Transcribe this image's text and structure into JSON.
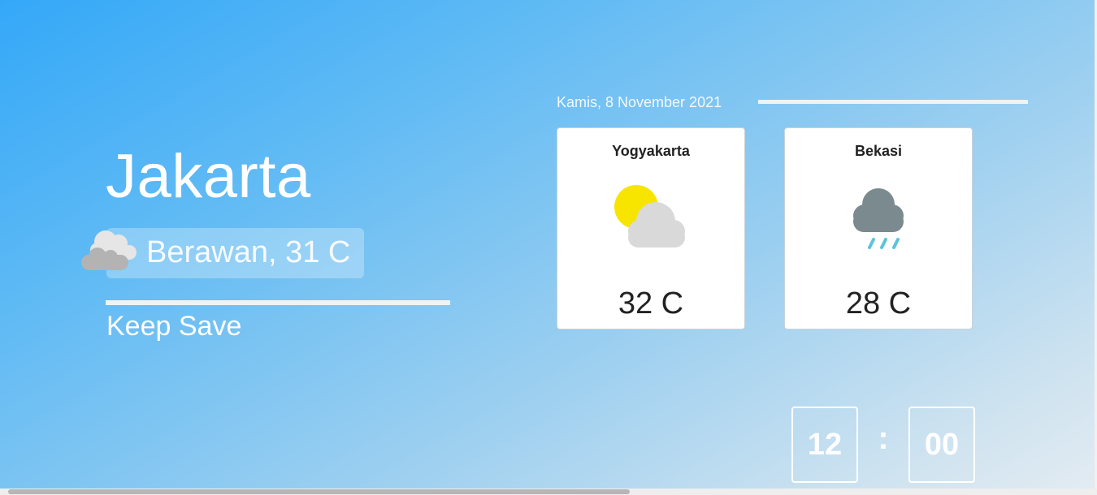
{
  "main": {
    "city": "Jakarta",
    "condition": "Berawan, 31 C",
    "condition_icon": "cloud-icon",
    "subtitle": "Keep Save"
  },
  "date": "Kamis, 8 November 2021",
  "cards": [
    {
      "city": "Yogyakarta",
      "icon": "partly-sunny-icon",
      "temp": "32 C"
    },
    {
      "city": "Bekasi",
      "icon": "rain-cloud-icon",
      "temp": "28 C"
    }
  ],
  "clock": {
    "hours": "12",
    "separator": ":",
    "minutes": "00"
  },
  "colors": {
    "background_start": "#34a8f8",
    "background_end": "#e4ecf2",
    "sun": "#f7e500",
    "cloud_light": "#d9d9d9",
    "rain_cloud": "#7b8a8f",
    "rain_drop": "#5bc4dc"
  }
}
